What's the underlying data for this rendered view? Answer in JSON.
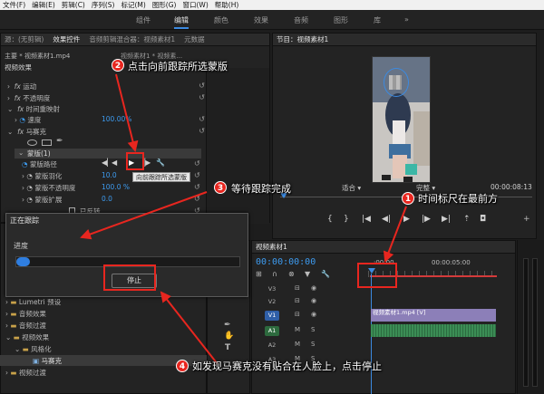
{
  "menu": [
    "文件(F)",
    "编辑(E)",
    "剪辑(C)",
    "序列(S)",
    "标记(M)",
    "图形(G)",
    "窗口(W)",
    "帮助(H)"
  ],
  "workspace": {
    "tabs": [
      "组件",
      "编辑",
      "颜色",
      "效果",
      "音频",
      "图形",
      "库"
    ],
    "active_index": 1,
    "more": "»"
  },
  "left_panel": {
    "tabs": [
      "源：(无剪辑)",
      "效果控件",
      "音频剪辑混合器：视频素材1",
      "元数据"
    ],
    "clip_path": "主要 * 视频素材1.mp4",
    "seq_ref": "视频素材1 * 视频素...",
    "section": "视频效果",
    "rows": {
      "motion": "运动",
      "opacity": "不透明度",
      "time_remap": "时间重映射",
      "speed": "速度",
      "speed_val": "100.00%",
      "mosaic": "马赛克",
      "mask": "蒙版(1)",
      "mask_path": "蒙版路径",
      "feather": "蒙版羽化",
      "feather_val": "10.0",
      "mask_opacity": "蒙版不透明度",
      "mask_opacity_val": "100.0 %",
      "expansion": "蒙版扩展",
      "expansion_val": "0.0",
      "inverted": "已反转"
    },
    "tooltip": "向前跟踪所选蒙版"
  },
  "effects_panel": {
    "items": [
      "Lumetri 预设",
      "音频效果",
      "音频过渡",
      "视频效果",
      "风格化",
      "马赛克",
      "视频过渡"
    ]
  },
  "dialog": {
    "title": "正在跟踪",
    "progress_label": "进度",
    "progress_fraction": 0.06,
    "stop": "停止"
  },
  "monitor": {
    "tab": "节目：视频素材1",
    "fit": "适合",
    "quality": "完整",
    "timecode": "00:00:08:13"
  },
  "timeline": {
    "tab": "视频素材1",
    "timecode": "00:00:00:00",
    "ruler_start": ":00:00",
    "ruler_mid": "00:00:05:00",
    "tracks": [
      "V3",
      "V2",
      "V1",
      "A1",
      "A2",
      "A3"
    ],
    "clip": "视频素材1.mp4 [V]"
  },
  "annotations": [
    {
      "n": "1",
      "text": "时间标尺在最前方"
    },
    {
      "n": "2",
      "text": "点击向前跟踪所选蒙版"
    },
    {
      "n": "3",
      "text": "等待跟踪完成"
    },
    {
      "n": "4",
      "text": "如发现马赛克没有贴合在人脸上，点击停止"
    }
  ],
  "colors": {
    "accent": "#3c8ae0",
    "annotation_red": "#e8261f",
    "value_blue": "#3d9bf0",
    "track_v": "#2f5fa8",
    "track_a": "#2d6a3e",
    "clip_v": "#8c7fb8",
    "clip_a": "#3b8d55"
  }
}
